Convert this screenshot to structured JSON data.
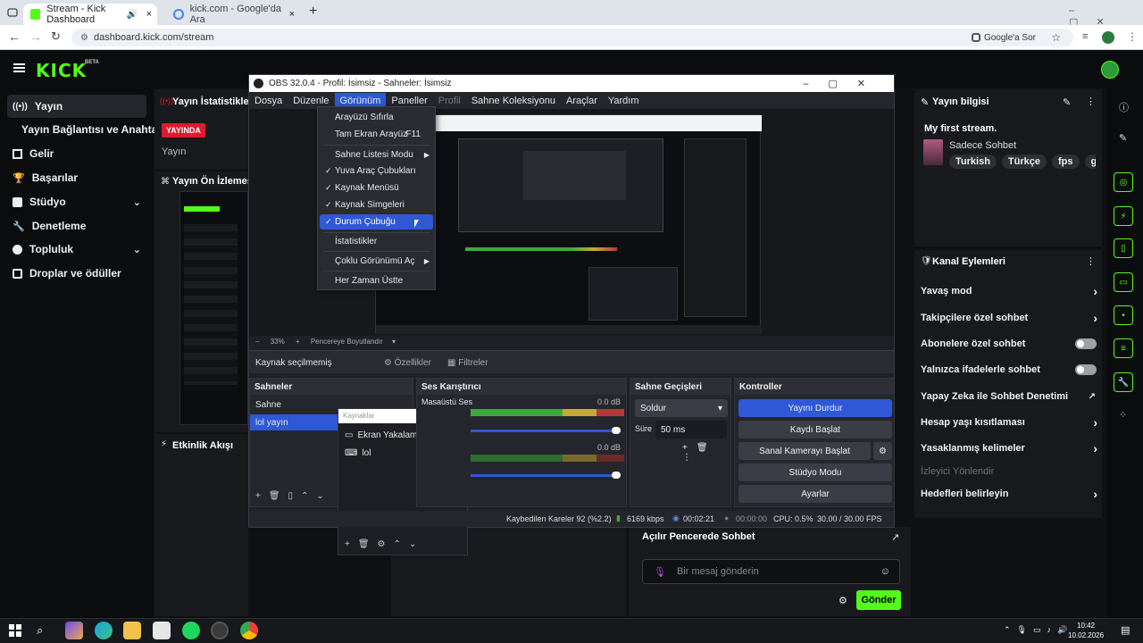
{
  "browser": {
    "tabs": [
      {
        "title": "Stream - Kick Dashboard",
        "favicon": "kick-favicon"
      },
      {
        "title": "kick.com - Google'da Ara",
        "favicon": "google-favicon"
      }
    ],
    "url": "dashboard.kick.com/stream",
    "google_search_label": "Google'a Sor"
  },
  "kick": {
    "logo": "KICK",
    "logo_badge": "BETA",
    "nav": [
      {
        "label": "Yayın",
        "icon": "broadcast-icon",
        "active": true
      },
      {
        "label": "Yayın Bağlantısı ve Anahtarı",
        "icon": "",
        "active": false
      },
      {
        "label": "Gelir",
        "icon": "revenue-icon",
        "active": false
      },
      {
        "label": "Başarılar",
        "icon": "trophy-icon",
        "active": false
      },
      {
        "label": "Stüdyo",
        "icon": "studio-icon",
        "active": false,
        "expandable": true
      },
      {
        "label": "Denetleme",
        "icon": "wrench-icon",
        "active": false
      },
      {
        "label": "Topluluk",
        "icon": "community-icon",
        "active": false,
        "expandable": true
      },
      {
        "label": "Droplar ve ödüller",
        "icon": "drops-icon",
        "active": false
      }
    ],
    "stats_panel": {
      "title": "Yayın İstatistikleri",
      "live_badge": "YAYINDA",
      "sub_label": "Yayın"
    },
    "preview_panel": {
      "title": "Yayın Ön İzlemesi"
    },
    "activity_panel": {
      "title": "Etkinlik Akışı"
    },
    "stream_info": {
      "title": "Yayın bilgisi",
      "stream_title": "My first stream.",
      "category": "Sadece Sohbet",
      "tags": [
        "Turkish",
        "Türkçe",
        "fps",
        "gaming"
      ]
    },
    "channel_actions": {
      "title": "Kanal Eylemleri",
      "items": [
        {
          "label": "Yavaş mod",
          "control": "arrow"
        },
        {
          "label": "Takipçilere özel sohbet",
          "control": "arrow"
        },
        {
          "label": "Abonelere özel sohbet",
          "control": "toggle"
        },
        {
          "label": "Yalnızca ifadelerle sohbet",
          "control": "toggle"
        },
        {
          "label": "Yapay Zeka ile Sohbet Denetimi",
          "control": "external"
        },
        {
          "label": "Hesap yaşı kısıtlaması",
          "control": "arrow"
        },
        {
          "label": "Yasaklanmış kelimeler",
          "control": "arrow"
        },
        {
          "label": "İzleyici Yönlendir",
          "control": "disabled"
        },
        {
          "label": "Hedefleri belirleyin",
          "control": "arrow"
        }
      ]
    },
    "chat": {
      "title": "Açılır Pencerede Sohbet",
      "placeholder": "Bir mesaj gönderin",
      "send_label": "Gönder"
    }
  },
  "obs": {
    "title": "OBS 32.0.4 - Profil: İsimsiz - Sahneler: İsimsiz",
    "menu": [
      "Dosya",
      "Düzenle",
      "Görünüm",
      "Paneller",
      "Profil",
      "Sahne Koleksiyonu",
      "Araçlar",
      "Yardım"
    ],
    "view_menu": [
      {
        "label": "Arayüzü Sıfırla",
        "checked": false
      },
      {
        "label": "Tam Ekran Arayüz",
        "shortcut": "F11",
        "checked": false
      },
      {
        "label": "Sahne Listesi Modu",
        "submenu": true,
        "checked": false
      },
      {
        "label": "Yuva Araç Çubukları",
        "checked": true
      },
      {
        "label": "Kaynak Menüsü",
        "checked": true
      },
      {
        "label": "Kaynak Simgeleri",
        "checked": true
      },
      {
        "label": "Durum Çubuğu",
        "checked": true,
        "highlighted": true
      },
      {
        "label": "İstatistikler",
        "checked": false
      },
      {
        "label": "Çoklu Görünümü Aç",
        "submenu": true,
        "checked": false
      },
      {
        "label": "Her Zaman Üstte",
        "checked": false
      }
    ],
    "zoom": "33%",
    "fit_label": "Pencereye Boyutlandır",
    "no_source": "Kaynak seçilmemiş",
    "properties_label": "Özellikler",
    "filters_label": "Filtreler",
    "scenes": {
      "title": "Sahneler",
      "items": [
        "Sahne",
        "lol yayın"
      ]
    },
    "sources": {
      "title": "Kaynaklar",
      "items": [
        "Ekran Yakalama",
        "lol"
      ]
    },
    "mixer": {
      "title": "Ses Karıştırıcı",
      "channels": [
        {
          "name": "Masaüstü Ses",
          "db": "0.0 dB"
        },
        {
          "name": "",
          "db": "0.0 dB"
        }
      ]
    },
    "transitions": {
      "title": "Sahne Geçişleri",
      "type": "Soldur",
      "duration_label": "Süre",
      "duration": "50 ms"
    },
    "controls": {
      "title": "Kontroller",
      "buttons": [
        "Yayını Durdur",
        "Kaydı Başlat",
        "Sanal Kamerayı Başlat",
        "Stüdyo Modu",
        "Ayarlar"
      ]
    },
    "status": {
      "dropped": "Kaybedilen Kareler 92 (%2.2)",
      "bitrate": "6169 kbps",
      "stream_time": "00:02:21",
      "rec_time": "00:00:00",
      "cpu": "CPU: 0.5%",
      "fps": "30.00 / 30.00 FPS"
    }
  },
  "taskbar": {
    "time": "10:42",
    "date": "10.02.2026"
  },
  "colors": {
    "kick_green": "#53fc18",
    "live_red": "#e0192d",
    "obs_blue": "#2f58d6"
  }
}
